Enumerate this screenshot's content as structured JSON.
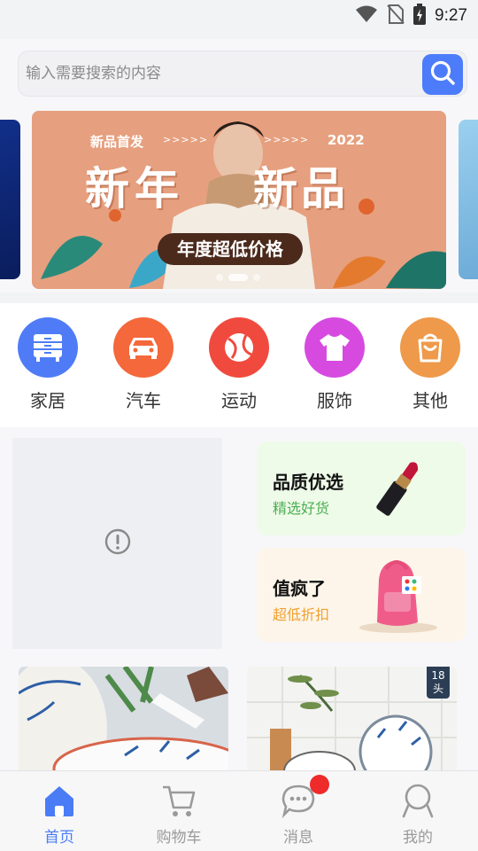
{
  "status_bar": {
    "time": "9:27",
    "icons": [
      "wifi-icon",
      "no-sim-icon",
      "battery-charging-icon"
    ]
  },
  "search": {
    "placeholder": "输入需要搜索的内容",
    "value": "",
    "button_icon": "search-icon",
    "accent": "#4d7cfb"
  },
  "banner": {
    "tag": "新品首发",
    "arrows": ">>>>>",
    "year": "2022",
    "headline_left": "新年",
    "headline_right": "新品",
    "sub_label": "年度超低价格",
    "dots": 3,
    "active_dot": 1,
    "background": "#e6a07f"
  },
  "categories": [
    {
      "label": "家居",
      "icon": "dresser-icon",
      "color": "#4f7cf6"
    },
    {
      "label": "汽车",
      "icon": "car-icon",
      "color": "#f4683c"
    },
    {
      "label": "运动",
      "icon": "ball-icon",
      "color": "#f04a3e"
    },
    {
      "label": "服饰",
      "icon": "shirt-icon",
      "color": "#d64ae0"
    },
    {
      "label": "其他",
      "icon": "bag-icon",
      "color": "#ee9a4a"
    }
  ],
  "promo": {
    "placeholder_icon": "error-icon",
    "cards": [
      {
        "title": "品质优选",
        "subtitle": "精选好货",
        "subtitle_color": "#4caf50",
        "bg": "#eefbe9",
        "image_icon": "lipstick-icon"
      },
      {
        "title": "值疯了",
        "subtitle": "超低折扣",
        "subtitle_color": "#f0a030",
        "bg": "#fdf5e9",
        "image_icon": "backpack-icon"
      }
    ]
  },
  "products": [
    {
      "image": "plate-spoon-image"
    },
    {
      "image": "tableware-image",
      "badge": [
        "18",
        "头"
      ]
    }
  ],
  "tabbar": {
    "active": "首页",
    "accent": "#4a7cf6",
    "tabs": [
      {
        "label": "首页",
        "icon": "home-icon"
      },
      {
        "label": "购物车",
        "icon": "cart-icon"
      },
      {
        "label": "消息",
        "icon": "message-icon",
        "has_dot": true
      },
      {
        "label": "我的",
        "icon": "user-icon"
      }
    ]
  }
}
